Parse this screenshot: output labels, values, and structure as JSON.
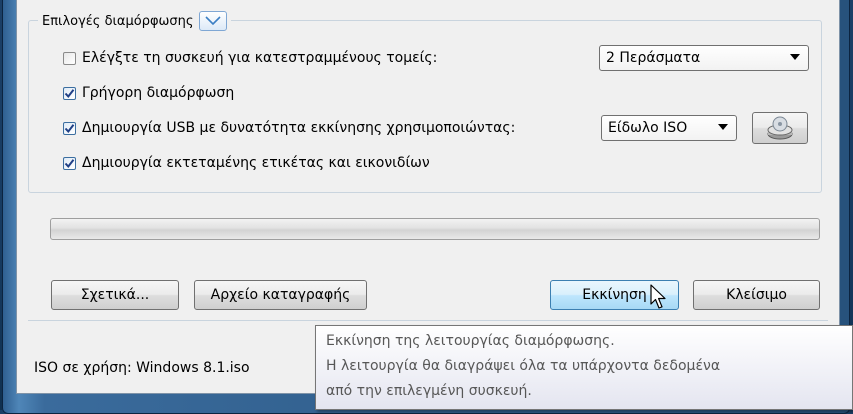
{
  "options": {
    "group_title": "Επιλογές διαμόρφωσης",
    "check_bad_sectors": {
      "label": "Ελέγξτε τη συσκευή για κατεστραμμένους τομείς:",
      "checked": false
    },
    "passes_select": {
      "value": "2 Περάσματα"
    },
    "quick_format": {
      "label": "Γρήγορη διαμόρφωση",
      "checked": true
    },
    "bootable_usb": {
      "label": "Δημιουργία USB με δυνατότητα εκκίνησης χρησιμοποιώντας:",
      "checked": true
    },
    "boot_type_select": {
      "value": "Είδωλο ISO"
    },
    "extended_label": {
      "label": "Δημιουργία εκτεταμένης ετικέτας και εικονιδίων",
      "checked": true
    }
  },
  "progress": {
    "value": 0
  },
  "buttons": {
    "about": "Σχετικά...",
    "log": "Αρχείο καταγραφής",
    "start": "Εκκίνηση",
    "close": "Κλείσιμο"
  },
  "status": {
    "text": "ISO σε χρήση: Windows 8.1.iso"
  },
  "tooltip": {
    "line1": "Εκκίνηση της λειτουργίας διαμόρφωσης.",
    "line2": "Η λειτουργία θα διαγράψει όλα τα υπάρχοντα δεδομένα",
    "line3": "από την επιλεγμένη συσκευή."
  },
  "icons": {
    "expander": "chevron-down-icon",
    "disc": "disc-drive-icon",
    "check": "checkmark-icon",
    "cursor": "mouse-pointer-icon"
  },
  "colors": {
    "desktop": "#163a60",
    "dialog": "#f0f0f0",
    "hot_button": "#bee6fd",
    "checkmark": "#1f3f86"
  }
}
